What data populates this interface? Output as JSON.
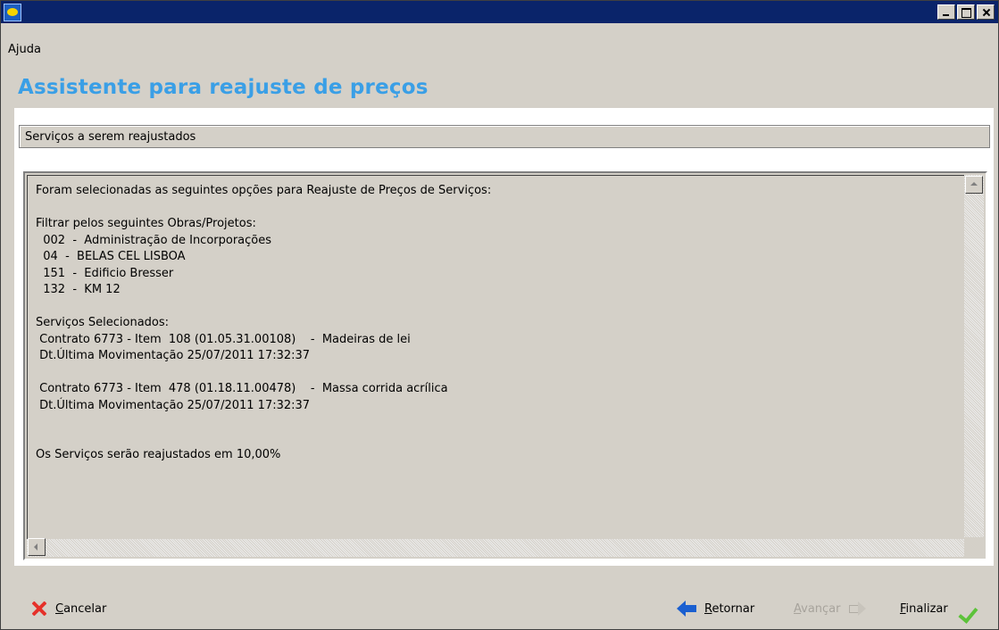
{
  "window": {
    "title": "",
    "buttons": [
      "minimize",
      "maximize",
      "close"
    ]
  },
  "menu": {
    "items": [
      "Ajuda"
    ]
  },
  "wizard": {
    "title": "Assistente para reajuste de preços",
    "section_label": "Serviços a serem reajustados",
    "summary_lines": [
      "Foram selecionadas as seguintes opções para Reajuste de Preços de Serviços:",
      "",
      "Filtrar pelos seguintes Obras/Projetos:",
      "  002  -  Administração de Incorporações",
      "  04  -  BELAS CEL LISBOA",
      "  151  -  Edificio Bresser",
      "  132  -  KM 12",
      "",
      "Serviços Selecionados:",
      " Contrato 6773 - Item  108 (01.05.31.00108)    -  Madeiras de lei",
      " Dt.Última Movimentação 25/07/2011 17:32:37",
      "",
      " Contrato 6773 - Item  478 (01.18.11.00478)    -  Massa corrida acrílica",
      " Dt.Última Movimentação 25/07/2011 17:32:37",
      "",
      "",
      "Os Serviços serão reajustados em 10,00%"
    ]
  },
  "footer": {
    "cancel": {
      "label": "Cancelar",
      "accel": "C",
      "rest": "ancelar",
      "icon": "x-icon",
      "enabled": true
    },
    "back": {
      "label": "Retornar",
      "accel": "R",
      "rest": "etornar",
      "icon": "arrow-left-icon",
      "enabled": true
    },
    "next": {
      "label": "Avançar",
      "accel": "A",
      "rest": "vançar",
      "icon": "arrow-right-icon",
      "enabled": false
    },
    "finish": {
      "label": "Finalizar",
      "accel": "F",
      "rest": "inalizar",
      "icon": "check-icon",
      "enabled": true
    }
  },
  "colors": {
    "title_blue": "#3a9fe6",
    "titlebar": "#0a246a",
    "face": "#d4d0c8",
    "cancel_red": "#e5312a",
    "back_blue": "#1a5fd0",
    "finish_green": "#5cc23a"
  }
}
